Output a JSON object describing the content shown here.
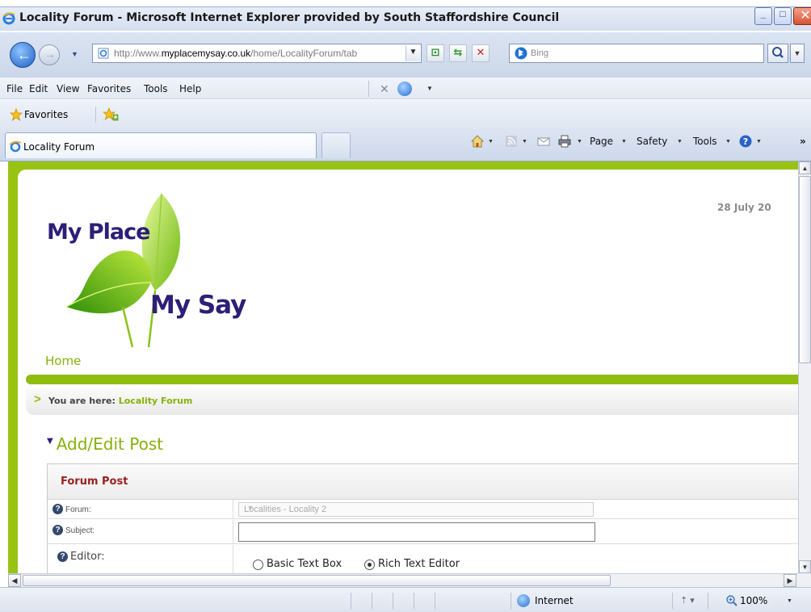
{
  "window": {
    "title": "Locality Forum - Microsoft Internet Explorer provided by South Staffordshire Council"
  },
  "address_bar": {
    "url_prefix": "http://www.",
    "url_domain": "myplacemysay.co.uk",
    "url_path": "/home/LocalityForum/tab",
    "search_placeholder": "Bing"
  },
  "menu": {
    "items": [
      "File",
      "Edit",
      "View",
      "Favorites",
      "Tools",
      "Help"
    ]
  },
  "favorites_bar": {
    "label": "Favorites"
  },
  "tabs": [
    {
      "label": "Locality Forum"
    }
  ],
  "command_bar": {
    "page": "Page",
    "safety": "Safety",
    "tools": "Tools"
  },
  "page": {
    "date": "28 July 20",
    "logo_line1": "My Place",
    "logo_line2": "My Say",
    "nav_home": "Home",
    "breadcrumb_prefix": "You are here:",
    "breadcrumb_current": "Locality Forum",
    "section_title": "Add/Edit Post",
    "form": {
      "header": "Forum Post",
      "forum_label": "Forum:",
      "forum_value": "Localities - Locality 2",
      "subject_label": "Subject:",
      "subject_value": "",
      "editor_label": "Editor:",
      "editor_options": [
        {
          "label": "Basic Text Box",
          "selected": false
        },
        {
          "label": "Rich Text Editor",
          "selected": true
        }
      ]
    }
  },
  "status_bar": {
    "zone": "Internet",
    "zoom": "100%"
  },
  "colors": {
    "brand_green": "#8fbd10",
    "link_green": "#86b10a",
    "logo_purple": "#2d1e76",
    "form_header_red": "#9a1f1f"
  }
}
